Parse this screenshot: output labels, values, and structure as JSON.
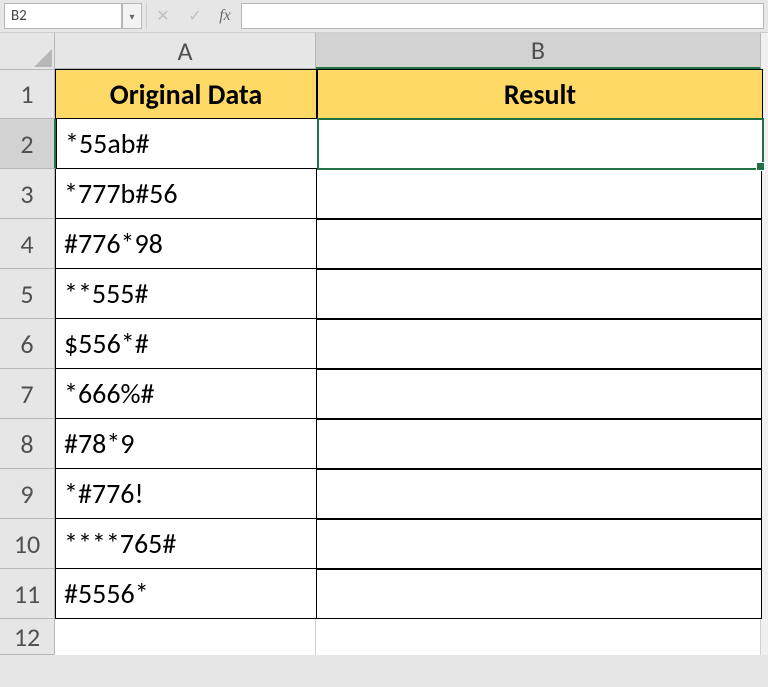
{
  "namebox": {
    "value": "B2"
  },
  "formula_bar": {
    "fx_label": "fx",
    "value": ""
  },
  "columns": {
    "A": "A",
    "B": "B"
  },
  "headers": {
    "A": "Original Data",
    "B": "Result"
  },
  "rows": [
    {
      "num": "1"
    },
    {
      "num": "2",
      "A": "*55ab#",
      "B": ""
    },
    {
      "num": "3",
      "A": "*777b#56",
      "B": ""
    },
    {
      "num": "4",
      "A": "#776*98",
      "B": ""
    },
    {
      "num": "5",
      "A": "**555#",
      "B": ""
    },
    {
      "num": "6",
      "A": "$556*#",
      "B": ""
    },
    {
      "num": "7",
      "A": "*666%#",
      "B": ""
    },
    {
      "num": "8",
      "A": "#78*9",
      "B": ""
    },
    {
      "num": "9",
      "A": "*#776!",
      "B": ""
    },
    {
      "num": "10",
      "A": "****765#",
      "B": ""
    },
    {
      "num": "11",
      "A": "#5556*",
      "B": ""
    },
    {
      "num": "12",
      "A": "",
      "B": ""
    }
  ],
  "active_cell": "B2",
  "colors": {
    "header_fill": "#fed966",
    "selection": "#217346"
  }
}
